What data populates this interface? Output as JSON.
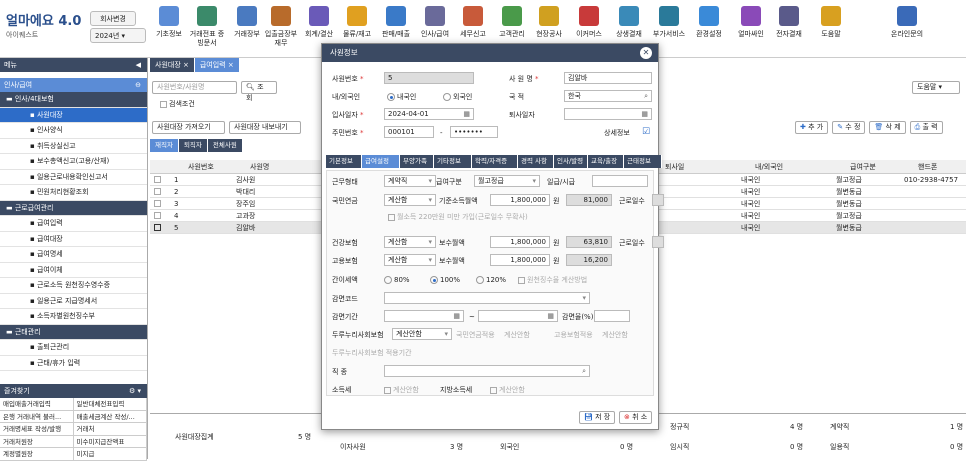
{
  "app": {
    "logo": "얼마에요 4.0",
    "company_sub": "아이퀘스트",
    "company_button": "회사변경",
    "year": "2024년"
  },
  "toolbar": [
    "기초정보",
    "거래전표 증빙문서",
    "거래장부",
    "입출금장부 재무",
    "회계/결산",
    "물류/재고",
    "판매/매출",
    "인사/급여",
    "세무신고",
    "고객관리",
    "현장공사",
    "이커머스",
    "상생결재",
    "부가서비스",
    "환경설정",
    "얼마싸인",
    "전자결재",
    "도움말",
    "온라인문의"
  ],
  "toolbar_colors": [
    "#5b8cd6",
    "#3b8a6a",
    "#4a7ac0",
    "#b86b2b",
    "#6a5ab8",
    "#e0a020",
    "#3a7ac8",
    "#6a6a9a",
    "#c85a3a",
    "#4a9a4a",
    "#d0a020",
    "#c83a3a",
    "#3a8ab8",
    "#2a7a9a",
    "#3a8ad8",
    "#8a4ab8",
    "#5a5a8a",
    "#d8a020",
    "#3a6ab8"
  ],
  "sidebar": {
    "menu_title": "메뉴",
    "section": "인사/급여",
    "items": [
      {
        "label": "인사/4대보험",
        "level": "group"
      },
      {
        "label": "사원대장",
        "level": "sel"
      },
      {
        "label": "인사양식",
        "level": "sub"
      },
      {
        "label": "취득상실신고",
        "level": "sub"
      },
      {
        "label": "보수총액신고(고용/산재)",
        "level": "sub"
      },
      {
        "label": "일용근로내용확인신고서",
        "level": "sub"
      },
      {
        "label": "민원처리현황조회",
        "level": "sub"
      },
      {
        "label": "근로급여관리",
        "level": "group"
      },
      {
        "label": "급여입력",
        "level": "sub"
      },
      {
        "label": "급여대장",
        "level": "sub"
      },
      {
        "label": "급여명세",
        "level": "sub"
      },
      {
        "label": "급여이체",
        "level": "sub"
      },
      {
        "label": "근로소득 원천징수영수증",
        "level": "sub"
      },
      {
        "label": "일용근로 지급명세서",
        "level": "sub"
      },
      {
        "label": "소득자별원천징수부",
        "level": "sub"
      },
      {
        "label": "근태관리",
        "level": "group"
      },
      {
        "label": "출퇴근관리",
        "level": "sub"
      },
      {
        "label": "근태/휴가 입력",
        "level": "sub"
      }
    ],
    "favorites_title": "즐겨찾기",
    "favorites": [
      [
        "매입매출거래입력",
        "일반대체전표입력"
      ],
      [
        "은행 거래내역 불러...",
        "매출세금계산 작성/..."
      ],
      [
        "거래명세표 작성/발행",
        "거래처"
      ],
      [
        "거래처원장",
        "미수미지급잔액표"
      ],
      [
        "계정별원장",
        "미지급"
      ]
    ]
  },
  "main": {
    "tabs": [
      "사원대장",
      "급여입력"
    ],
    "search_placeholder": "사원번호/사원명",
    "search_button": "조 회",
    "search_condition": "검색조건",
    "btn_import": "사원대장 가져오기",
    "btn_export": "사원대장 내보내기",
    "help": "도움말",
    "subtabs": [
      "재직자",
      "퇴직자",
      "전체사원"
    ],
    "actions": [
      "추 가",
      "수 정",
      "삭 제",
      "출 력"
    ],
    "columns": [
      "사원번호",
      "사원명",
      "퇴사일",
      "내/외국인",
      "급여구분",
      "핸드폰"
    ],
    "rows": [
      {
        "no": "1",
        "name": "김사원",
        "resign": "",
        "nat": "내국인",
        "pay": "월고정급",
        "phone": "010-2938-4757"
      },
      {
        "no": "2",
        "name": "박대리",
        "resign": "",
        "nat": "내국인",
        "pay": "월변동급",
        "phone": ""
      },
      {
        "no": "3",
        "name": "장주임",
        "resign": "",
        "nat": "내국인",
        "pay": "월변동급",
        "phone": ""
      },
      {
        "no": "4",
        "name": "고과장",
        "resign": "",
        "nat": "내국인",
        "pay": "월고정급",
        "phone": ""
      },
      {
        "no": "5",
        "name": "김알바",
        "resign": "",
        "nat": "내국인",
        "pay": "월변동급",
        "phone": ""
      }
    ]
  },
  "summary": {
    "title": "사원대장집계",
    "total": "5 명",
    "r1": [
      [
        "정규직",
        "4 명"
      ],
      [
        "계약직",
        "1 명"
      ]
    ],
    "r2": [
      [
        "이자사원",
        "3 명"
      ],
      [
        "외국인",
        "0 명"
      ],
      [
        "임시직",
        "0 명"
      ],
      [
        "일용직",
        "0 명"
      ]
    ]
  },
  "modal": {
    "title": "사원정보",
    "emp_no_label": "사원번호",
    "emp_no": "5",
    "emp_name_label": "사 원 명",
    "emp_name": "김알바",
    "nat_label": "내/외국인",
    "nat_opts": [
      "내국인",
      "외국인"
    ],
    "country_label": "국 적",
    "country": "한국",
    "join_label": "입사일자",
    "join": "2024-04-01",
    "resign_label": "퇴사일자",
    "rrn_label": "주민번호",
    "rrn1": "000101",
    "rrn2": "•••••••",
    "detail_label": "상세정보",
    "tabs": [
      "기본정보",
      "급여설정",
      "부양가족",
      "기타정보",
      "학력/자격증",
      "경력 사항",
      "인사/발령",
      "교육/출장",
      "근태정보"
    ],
    "work_type_label": "근무형태",
    "work_type": "계약직",
    "pay_type_label": "급여구분",
    "pay_type": "월고정급",
    "daily_label": "일급/시급",
    "np_label": "국민연금",
    "np_mode": "계산함",
    "np_base_label": "기준소득월액",
    "np_base": "1,800,000",
    "np_amt": "81,000",
    "won": "원",
    "days_label": "근로일수",
    "np_note": "월소득 220만원 미만 가입(근로일수 무확사)",
    "hi_label": "건강보험",
    "hi_mode": "계산함",
    "hi_base_label": "보수월액",
    "hi_base": "1,800,000",
    "hi_amt": "63,810",
    "ei_label": "고용보험",
    "ei_mode": "계산함",
    "ei_base_label": "보수월액",
    "ei_base": "1,800,000",
    "ei_amt": "16,200",
    "tax_label": "간이세액",
    "tax_opts": [
      "80%",
      "100%",
      "120%"
    ],
    "tax_note": "원천징수율 계산방법",
    "reduce_code_label": "감면코드",
    "reduce_period_label": "감면기간",
    "reduce_tilde": "~",
    "reduce_rate_label": "감면율(%)",
    "duru_label": "두루누리사회보험",
    "duru_mode": "계산안함",
    "duru_np": "국민연금적용",
    "duru_np_mode": "계산안함",
    "duru_ei": "고용보험적용",
    "duru_ei_mode": "계산안함",
    "duru_period_label": "두루누리사회보험 적용기간",
    "job_label": "직 종",
    "income_tax_label": "소득세",
    "income_tax_opt": "계산안함",
    "local_tax_label": "지방소득세",
    "local_tax_opt": "계산안함",
    "save": "저 장",
    "cancel": "취 소"
  }
}
